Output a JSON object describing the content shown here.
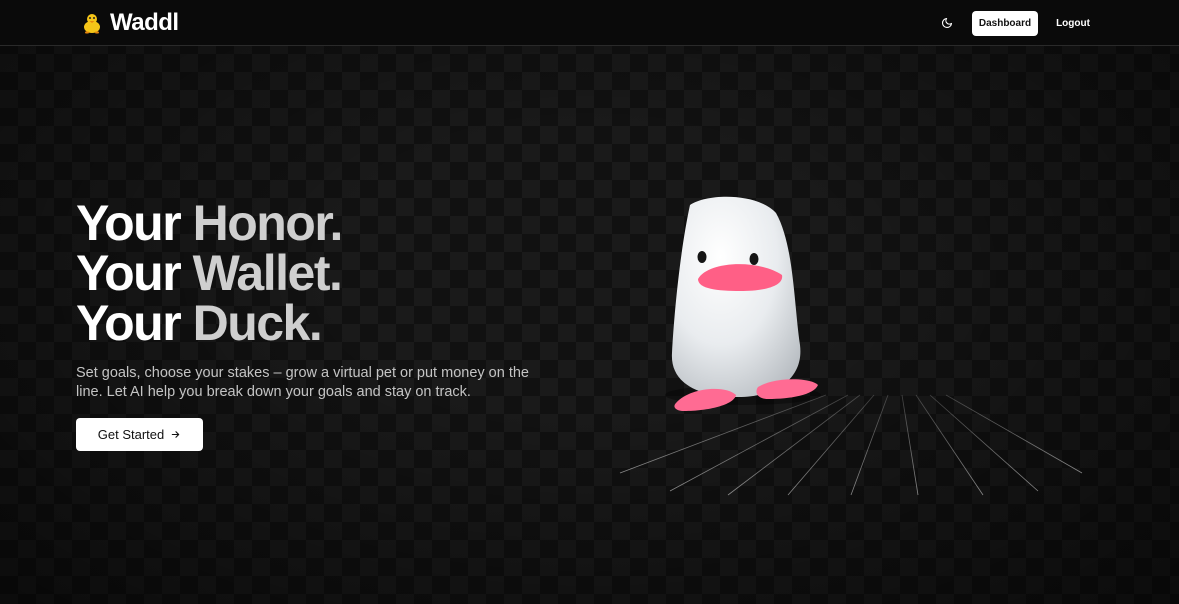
{
  "nav": {
    "brand_name": "Waddl",
    "brand_icon": "duck-icon",
    "theme_toggle_icon": "moon-icon",
    "dashboard_label": "Dashboard",
    "logout_label": "Logout"
  },
  "hero": {
    "title_lines": [
      {
        "first": "Your",
        "second": "Honor."
      },
      {
        "first": "Your",
        "second": "Wallet."
      },
      {
        "first": "Your",
        "second": "Duck."
      }
    ],
    "subtitle": "Set goals, choose your stakes – grow a virtual pet or put money on the line. Let AI help you break down your goals and stay on track.",
    "cta_label": "Get Started",
    "cta_icon": "arrow-right-icon"
  },
  "scene": {
    "model": "duck-mascot-3d",
    "colors": {
      "body": "#e9ecef",
      "beak": "#ff5f86",
      "feet": "#ff6b93",
      "grid": "#4a4a4a"
    }
  },
  "theme": {
    "accent": "#ffffff",
    "background": "#111111",
    "brand_icon_color": "#f5c518"
  }
}
